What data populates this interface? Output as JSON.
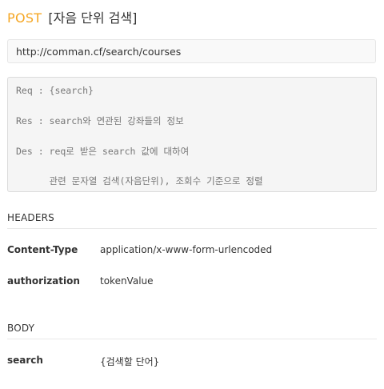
{
  "endpoint": {
    "method": "POST",
    "name": "[자음 단위 검색]",
    "url": "http://comman.cf/search/courses"
  },
  "description_lines": [
    "Req : {search}",
    "Res : search와 연관된 강좌들의 정보",
    "Des : req로 받은 search 값에 대하여",
    "      관련 문자열 검색(자음단위), 조회수 기준으로 정렬"
  ],
  "headers": {
    "title": "HEADERS",
    "rows": [
      {
        "key": "Content-Type",
        "value": "application/x-www-form-urlencoded"
      },
      {
        "key": "authorization",
        "value": "tokenValue"
      }
    ]
  },
  "body": {
    "title": "BODY",
    "rows": [
      {
        "key": "search",
        "value": "{검색할 단어}"
      }
    ]
  },
  "colors": {
    "method": "#f5a623",
    "code_background": "#f5f5f5",
    "code_text": "#777777"
  }
}
